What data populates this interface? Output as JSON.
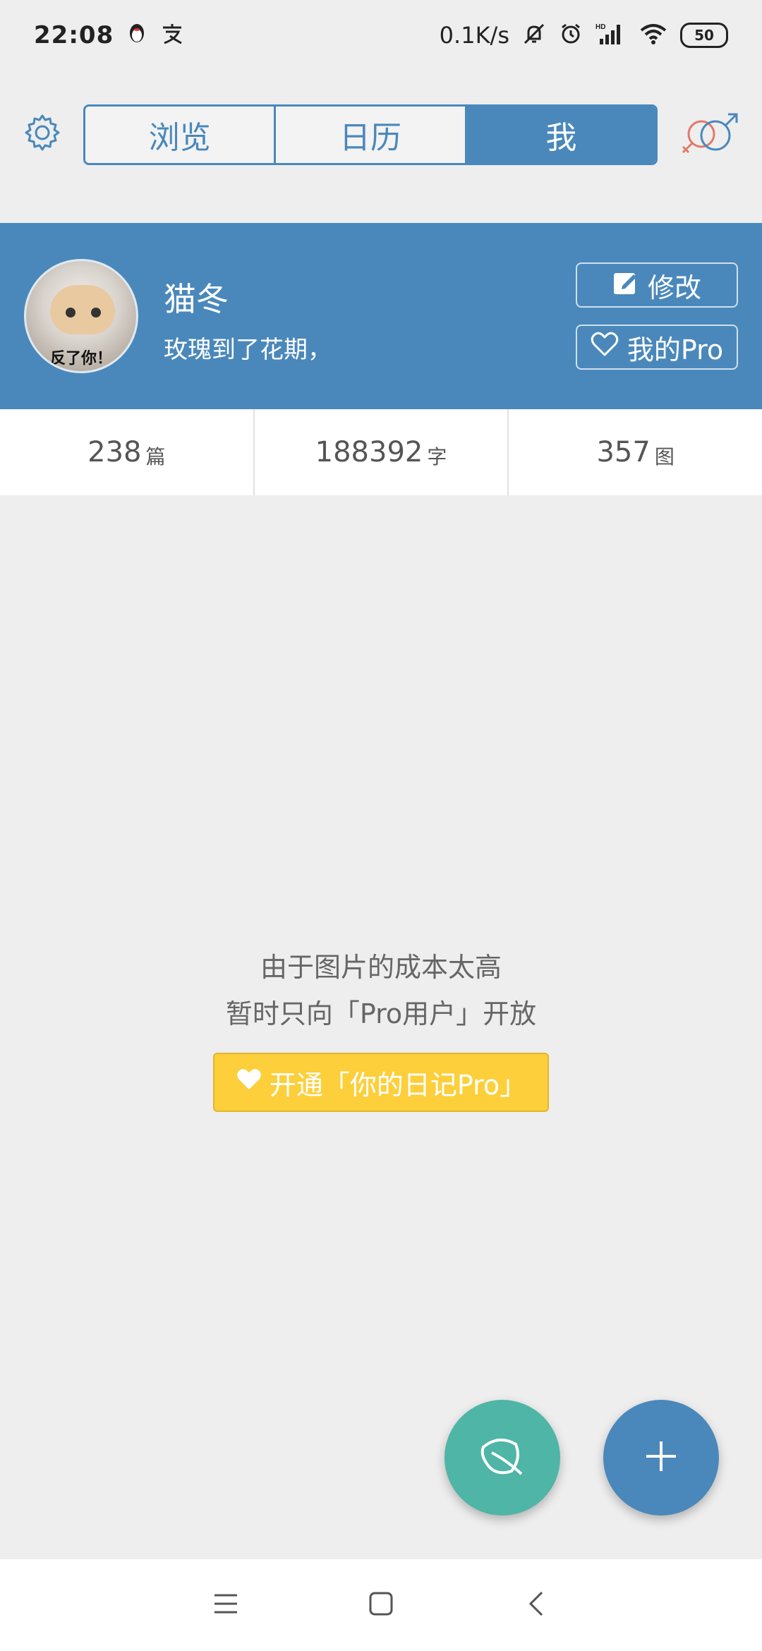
{
  "status_bar": {
    "time": "22:08",
    "network_speed": "0.1K/s",
    "battery": "50",
    "icons": [
      "qq-icon",
      "alipay-icon",
      "mute-bell-icon",
      "alarm-icon",
      "hd-signal-icon",
      "wifi-icon",
      "battery-icon"
    ]
  },
  "header": {
    "tabs": [
      {
        "label": "浏览",
        "active": false
      },
      {
        "label": "日历",
        "active": false
      },
      {
        "label": "我",
        "active": true
      }
    ]
  },
  "profile": {
    "name": "猫冬",
    "bio": "玫瑰到了花期，",
    "avatar_caption": "反了你！",
    "edit_label": "修改",
    "pro_label": "我的Pro"
  },
  "stats": [
    {
      "value": "238",
      "unit": "篇"
    },
    {
      "value": "188392",
      "unit": "字"
    },
    {
      "value": "357",
      "unit": "图"
    }
  ],
  "message": {
    "line1": "由于图片的成本太高",
    "line2": "暂时只向「Pro用户」开放",
    "cta_label": "开通「你的日记Pro」"
  },
  "colors": {
    "primary": "#4a88bb",
    "teal": "#4fb5a6",
    "cta_yellow": "#fccf3b",
    "background": "#eeeeee"
  }
}
